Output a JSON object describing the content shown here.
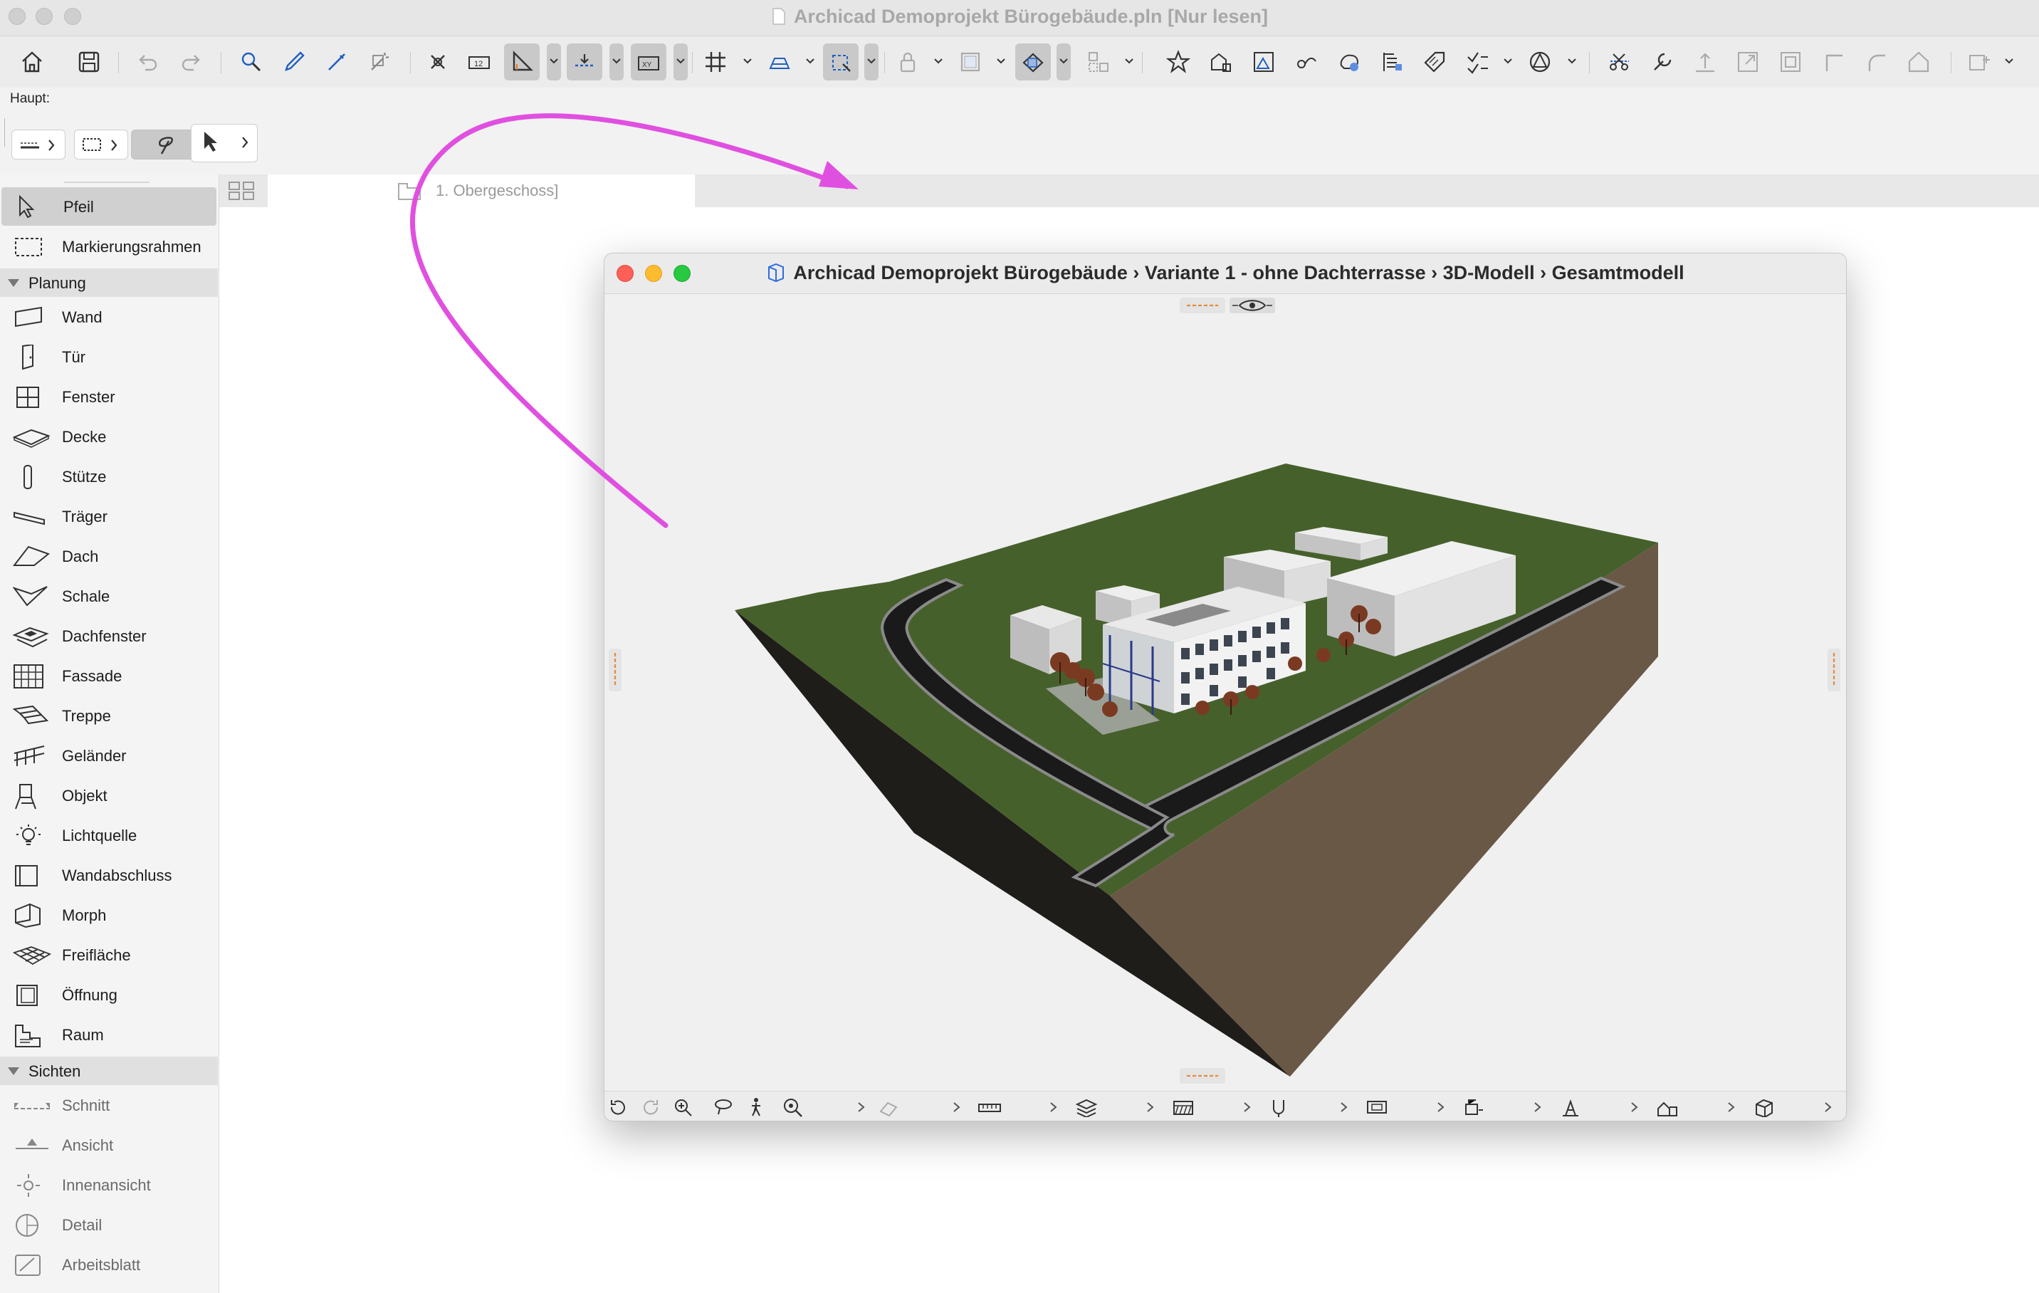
{
  "app": {
    "title": "Archicad Demoprojekt Bürogebäude.pln [Nur lesen]"
  },
  "toolbar": {
    "label": "Haupt:",
    "buttons": [
      "home-icon",
      "save-icon",
      "undo-icon",
      "redo-icon",
      "find-select-icon",
      "eyedropper-icon",
      "syringe-icon",
      "magic-wand-icon",
      "fit-icon",
      "measure-icon",
      "ruler-angle-icon",
      "gravity-icon",
      "coordinates-icon",
      "grid-snap-icon",
      "snap-guides-icon",
      "select-frame-icon",
      "lock-icon",
      "layer-icon",
      "ghost-icon",
      "group-icon",
      "favorites-icon",
      "renovation-icon",
      "drawing-icon",
      "trace-icon",
      "graphic-override-icon",
      "schedule-icon",
      "tag-icon",
      "check-icon",
      "morph-icon",
      "split-icon",
      "adjust-icon",
      "elevate-icon",
      "resize-icon",
      "offset-icon",
      "corner-icon",
      "fillet-icon",
      "roof-icon",
      "layout-icon"
    ]
  },
  "tab": {
    "label": "1. Obergeschoss]"
  },
  "toolbox": {
    "top_items": [
      {
        "label": "Pfeil",
        "icon": "arrow-icon"
      },
      {
        "label": "Markierungsrahmen",
        "icon": "marquee-icon"
      }
    ],
    "groups": [
      {
        "label": "Planung",
        "items": [
          {
            "label": "Wand",
            "icon": "wall-icon"
          },
          {
            "label": "Tür",
            "icon": "door-icon"
          },
          {
            "label": "Fenster",
            "icon": "window-icon"
          },
          {
            "label": "Decke",
            "icon": "slab-icon"
          },
          {
            "label": "Stütze",
            "icon": "column-icon"
          },
          {
            "label": "Träger",
            "icon": "beam-icon"
          },
          {
            "label": "Dach",
            "icon": "roof-icon"
          },
          {
            "label": "Schale",
            "icon": "shell-icon"
          },
          {
            "label": "Dachfenster",
            "icon": "skylight-icon"
          },
          {
            "label": "Fassade",
            "icon": "curtain-wall-icon"
          },
          {
            "label": "Treppe",
            "icon": "stair-icon"
          },
          {
            "label": "Geländer",
            "icon": "railing-icon"
          },
          {
            "label": "Objekt",
            "icon": "object-icon"
          },
          {
            "label": "Lichtquelle",
            "icon": "lamp-icon"
          },
          {
            "label": "Wandabschluss",
            "icon": "wall-end-icon"
          },
          {
            "label": "Morph",
            "icon": "morph-icon"
          },
          {
            "label": "Freifläche",
            "icon": "mesh-icon"
          },
          {
            "label": "Öffnung",
            "icon": "opening-icon"
          },
          {
            "label": "Raum",
            "icon": "zone-icon"
          }
        ]
      },
      {
        "label": "Sichten",
        "items": [
          {
            "label": "Schnitt",
            "icon": "section-icon"
          },
          {
            "label": "Ansicht",
            "icon": "elevation-icon"
          },
          {
            "label": "Innenansicht",
            "icon": "interior-elevation-icon"
          },
          {
            "label": "Detail",
            "icon": "detail-icon"
          },
          {
            "label": "Arbeitsblatt",
            "icon": "worksheet-icon"
          }
        ]
      }
    ]
  },
  "window3d": {
    "title": "Archicad Demoprojekt Bürogebäude › Variante 1 - ohne Dachterrasse › 3D-Modell › Gesamtmodell",
    "bottom_tools": [
      "orbit-icon",
      "redo-view-icon",
      "zoom-in-icon",
      "lasso-icon",
      "walk-icon",
      "zoom-fit-icon",
      "surface-icon",
      "scale-icon",
      "layers-icon",
      "pen-set-icon",
      "dimension-icon",
      "model-view-icon",
      "renovation-filter-icon",
      "structure-icon",
      "filter-icon",
      "3d-style-icon"
    ]
  },
  "colors": {
    "annotation_arrow": "#e050e0",
    "grass": "#46602b",
    "road": "#1a1a1a",
    "soil": "#6a5847",
    "side_dark": "#1f1d1a"
  }
}
